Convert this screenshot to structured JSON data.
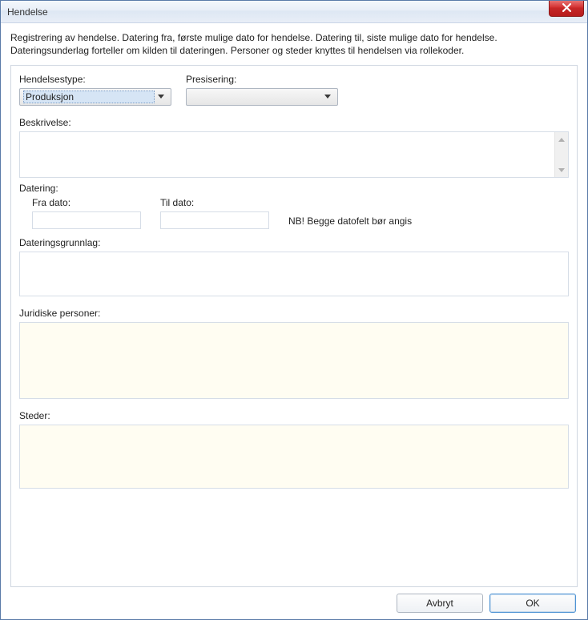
{
  "window": {
    "title": "Hendelse"
  },
  "intro": "Registrering av hendelse. Datering fra, første mulige dato for hendelse. Datering til, siste mulige dato for hendelse. Dateringsunderlag forteller om kilden til dateringen. Personer og steder knyttes til hendelsen via rollekoder.",
  "labels": {
    "hendelsestype": "Hendelsestype:",
    "presisering": "Presisering:",
    "beskrivelse": "Beskrivelse:",
    "datering": "Datering:",
    "fra_dato": "Fra dato:",
    "til_dato": "Til dato:",
    "dateringsgrunnlag": "Dateringsgrunnlag:",
    "juridiske_personer": "Juridiske personer:",
    "steder": "Steder:"
  },
  "fields": {
    "hendelsestype": {
      "value": "Produksjon"
    },
    "presisering": {
      "value": ""
    },
    "beskrivelse": {
      "value": ""
    },
    "fra_dato": {
      "value": ""
    },
    "til_dato": {
      "value": ""
    },
    "date_note": "NB! Begge datofelt bør angis"
  },
  "buttons": {
    "cancel": "Avbryt",
    "ok": "OK"
  }
}
